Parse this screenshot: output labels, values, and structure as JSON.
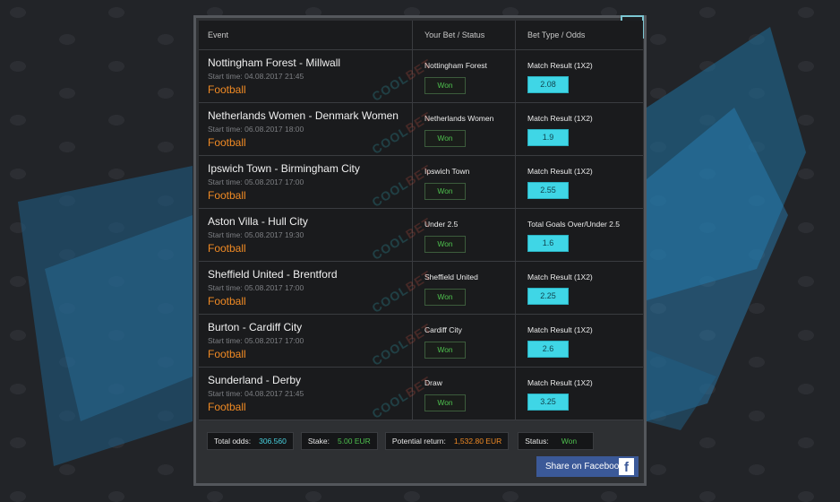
{
  "header": {
    "event": "Event",
    "your_bet": "Your Bet / Status",
    "bet_type": "Bet Type / Odds"
  },
  "close_label": "×",
  "rows": [
    {
      "event": "Nottingham Forest - Millwall",
      "start": "Start time: 04.08.2017 21:45",
      "sport": "Football",
      "pick": "Nottingham Forest",
      "status": "Won",
      "bet_type": "Match Result (1X2)",
      "odds": "2.08"
    },
    {
      "event": "Netherlands Women - Denmark Women",
      "start": "Start time: 06.08.2017 18:00",
      "sport": "Football",
      "pick": "Netherlands Women",
      "status": "Won",
      "bet_type": "Match Result (1X2)",
      "odds": "1.9"
    },
    {
      "event": "Ipswich Town - Birmingham City",
      "start": "Start time: 05.08.2017 17:00",
      "sport": "Football",
      "pick": "Ipswich Town",
      "status": "Won",
      "bet_type": "Match Result (1X2)",
      "odds": "2.55"
    },
    {
      "event": "Aston Villa - Hull City",
      "start": "Start time: 05.08.2017 19:30",
      "sport": "Football",
      "pick": "Under 2.5",
      "status": "Won",
      "bet_type": "Total Goals Over/Under 2.5",
      "odds": "1.6"
    },
    {
      "event": "Sheffield United - Brentford",
      "start": "Start time: 05.08.2017 17:00",
      "sport": "Football",
      "pick": "Sheffield United",
      "status": "Won",
      "bet_type": "Match Result (1X2)",
      "odds": "2.25"
    },
    {
      "event": "Burton - Cardiff City",
      "start": "Start time: 05.08.2017 17:00",
      "sport": "Football",
      "pick": "Cardiff City",
      "status": "Won",
      "bet_type": "Match Result (1X2)",
      "odds": "2.6"
    },
    {
      "event": "Sunderland - Derby",
      "start": "Start time: 04.08.2017 21:45",
      "sport": "Football",
      "pick": "Draw",
      "status": "Won",
      "bet_type": "Match Result (1X2)",
      "odds": "3.25"
    }
  ],
  "watermark": {
    "part1": "COOL",
    "part2": "BET"
  },
  "footer": {
    "total_odds_label": "Total odds:",
    "total_odds": "306.560",
    "stake_label": "Stake:",
    "stake": "5.00 EUR",
    "return_label": "Potential return:",
    "return": "1,532.80 EUR",
    "status_label": "Status:",
    "status": "Won"
  },
  "share": {
    "label": "Share on Facebook",
    "icon": "facebook-icon",
    "icon_glyph": "f"
  },
  "colors": {
    "accent": "#3fd6e6",
    "sport": "#f08a24",
    "won": "#4ec04e",
    "facebook": "#3b5998"
  }
}
